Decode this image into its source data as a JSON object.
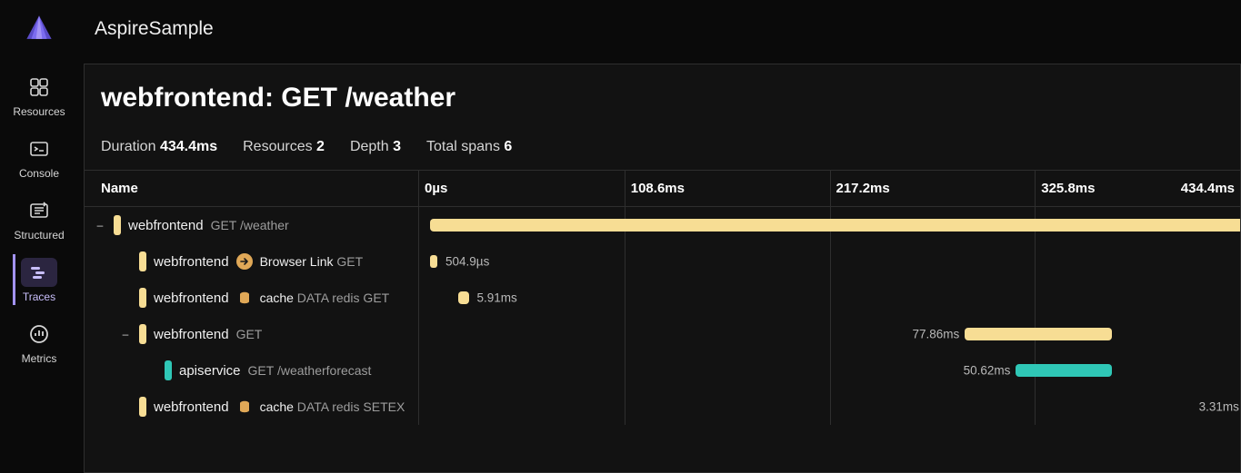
{
  "app_name": "AspireSample",
  "nav": {
    "items": [
      {
        "id": "resources",
        "label": "Resources",
        "icon": "resources",
        "active": false
      },
      {
        "id": "console",
        "label": "Console",
        "icon": "console",
        "active": false
      },
      {
        "id": "structured",
        "label": "Structured",
        "icon": "structured",
        "active": false
      },
      {
        "id": "traces",
        "label": "Traces",
        "icon": "traces",
        "active": true
      },
      {
        "id": "metrics",
        "label": "Metrics",
        "icon": "metrics",
        "active": false
      }
    ]
  },
  "page": {
    "title": "webfrontend: GET /weather"
  },
  "summary": {
    "duration_label": "Duration",
    "duration_value": "434.4ms",
    "resources_label": "Resources",
    "resources_value": "2",
    "depth_label": "Depth",
    "depth_value": "3",
    "spans_label": "Total spans",
    "spans_value": "6"
  },
  "columns": {
    "name": "Name"
  },
  "axis": {
    "ticks": [
      "0µs",
      "108.6ms",
      "217.2ms",
      "325.8ms",
      "434.4ms"
    ]
  },
  "colors": {
    "webfrontend": "#f7dd94",
    "apiservice": "#2fc7b6",
    "icon_db": "#e0a857",
    "icon_link": "#e0a857"
  },
  "chart_data": {
    "type": "bar",
    "x_range_ms": [
      0,
      434.4
    ],
    "unit": "ms",
    "spans": [
      {
        "id": 0,
        "depth": 0,
        "service": "webfrontend",
        "operation": "GET /weather",
        "icon": null,
        "start_ms": 0.0,
        "duration_ms": 434.4,
        "label": null,
        "expandable": true
      },
      {
        "id": 1,
        "depth": 1,
        "service": "webfrontend",
        "operation": "Browser Link   GET",
        "icon": "link",
        "start_ms": 0.0,
        "duration_ms": 0.5049,
        "label": "504.9µs",
        "expandable": false
      },
      {
        "id": 2,
        "depth": 1,
        "service": "webfrontend",
        "operation": "cache   DATA redis GET",
        "icon": "db",
        "start_ms": 15.0,
        "duration_ms": 5.91,
        "label": "5.91ms",
        "expandable": false
      },
      {
        "id": 3,
        "depth": 1,
        "service": "webfrontend",
        "operation": "GET",
        "icon": null,
        "start_ms": 283.0,
        "duration_ms": 77.86,
        "label": "77.86ms",
        "expandable": true
      },
      {
        "id": 4,
        "depth": 2,
        "service": "apiservice",
        "operation": "GET /weatherforecast",
        "icon": null,
        "start_ms": 310.0,
        "duration_ms": 50.62,
        "label": "50.62ms",
        "expandable": false
      },
      {
        "id": 5,
        "depth": 1,
        "service": "webfrontend",
        "operation": "cache   DATA redis SETEX",
        "icon": "db",
        "start_ms": 431.0,
        "duration_ms": 3.31,
        "label": "3.31ms",
        "expandable": false
      }
    ]
  }
}
